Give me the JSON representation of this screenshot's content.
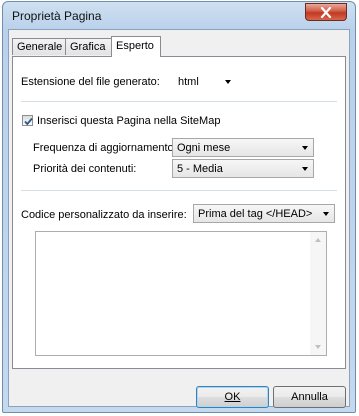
{
  "window": {
    "title": "Proprietà Pagina"
  },
  "tabs": [
    {
      "label": "Generale",
      "active": false
    },
    {
      "label": "Grafica",
      "active": false
    },
    {
      "label": "Esperto",
      "active": true
    }
  ],
  "extension": {
    "label": "Estensione del file generato:",
    "value": "html"
  },
  "sitemap": {
    "checkbox_label": "Inserisci questa Pagina nella SiteMap",
    "checked": true,
    "frequency_label": "Frequenza di aggiornamento:",
    "frequency_value": "Ogni mese",
    "priority_label": "Priorità dei contenuti:",
    "priority_value": "5 - Media"
  },
  "custom_code": {
    "label": "Codice personalizzato da inserire:",
    "position_value": "Prima del tag </HEAD>",
    "text": ""
  },
  "buttons": {
    "ok_label": "OK",
    "cancel_label": "Annulla"
  }
}
